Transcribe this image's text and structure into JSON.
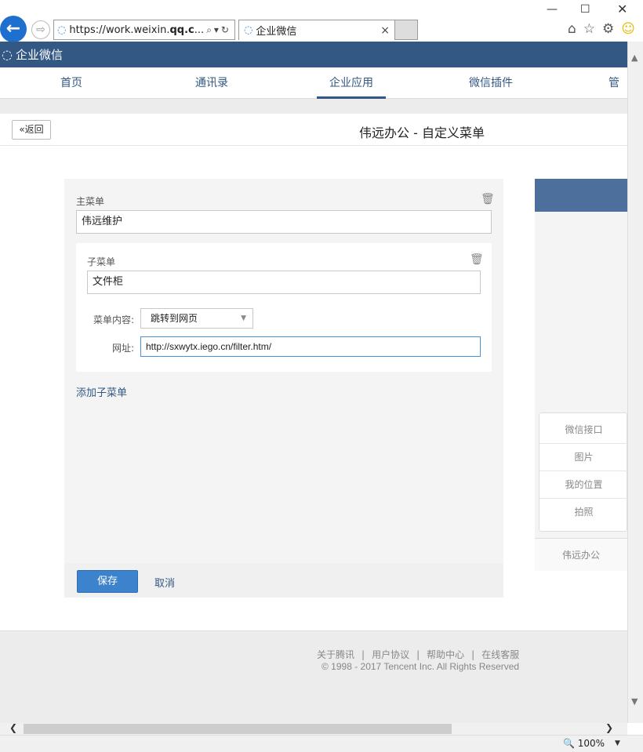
{
  "browser": {
    "url_prefix": "https://work.weixin.",
    "url_bold": "qq.c",
    "url_suffix": "...",
    "tab_title": "企业微信"
  },
  "app": {
    "name": "企业微信",
    "nav": [
      "首页",
      "通讯录",
      "企业应用",
      "微信插件",
      "管理"
    ],
    "active_nav": "企业应用"
  },
  "page": {
    "back_label": "返回",
    "title": "伟远办公 - 自定义菜单"
  },
  "editor": {
    "main_menu_label": "主菜单",
    "main_menu_value": "伟远维护",
    "sub_menu_label": "子菜单",
    "sub_menu_value": "文件柜",
    "content_label": "菜单内容:",
    "content_value": "跳转到网页",
    "url_label": "网址:",
    "url_value": "http://sxwytx.iego.cn/filter.htm/",
    "add_sub_label": "添加子菜单",
    "save_label": "保存",
    "cancel_label": "取消"
  },
  "preview": {
    "popup_items": [
      "微信接口",
      "图片",
      "我的位置",
      "拍照"
    ],
    "bottom_menu": "伟远办公"
  },
  "footer": {
    "links": [
      "关于腾讯",
      "用户协议",
      "帮助中心",
      "在线客服"
    ],
    "copyright": "© 1998 - 2017 Tencent Inc. All Rights Reserved"
  },
  "status": {
    "zoom": "100%"
  }
}
